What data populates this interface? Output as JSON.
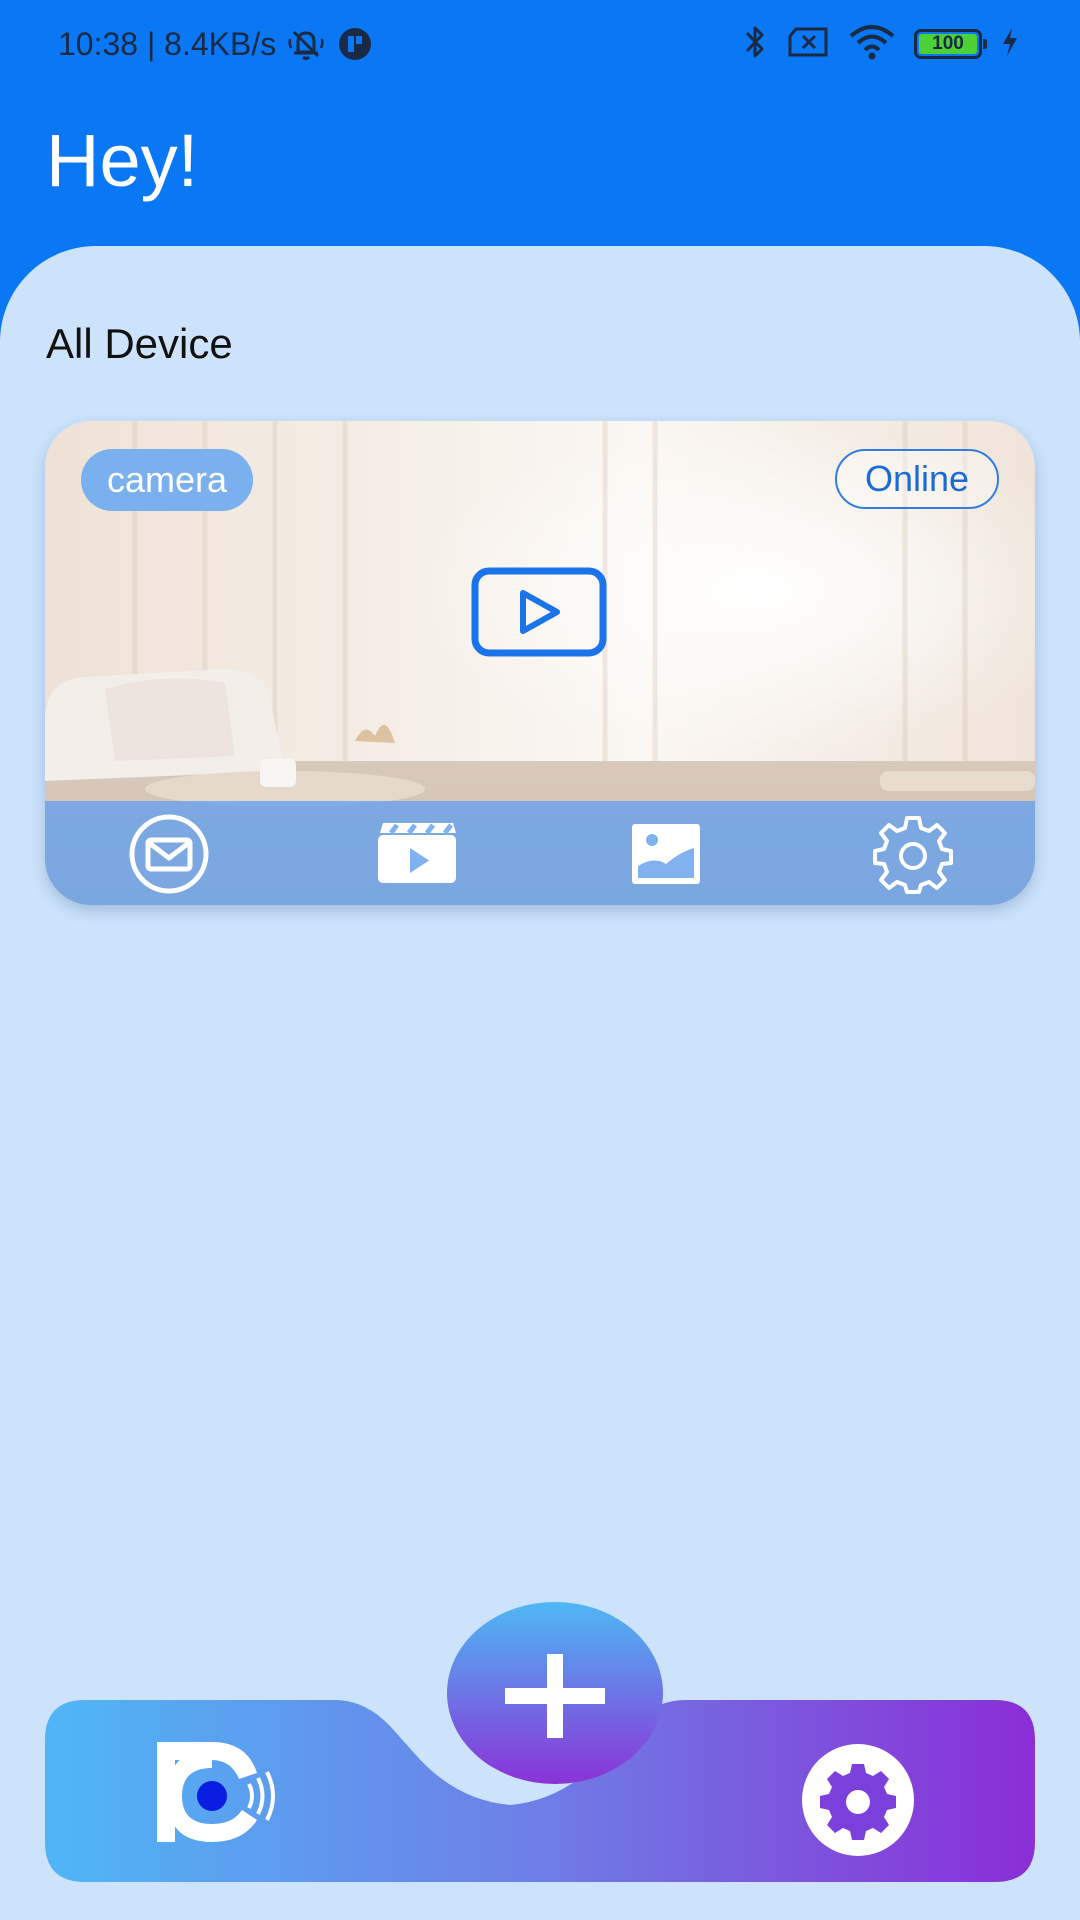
{
  "status_bar": {
    "time_speed": "10:38 | 8.4KB/s",
    "battery_level": "100",
    "icons": [
      "mute-bell-icon",
      "app-icon",
      "bluetooth-icon",
      "no-sim-icon",
      "wifi-icon",
      "battery-icon",
      "charging-icon"
    ]
  },
  "header": {
    "greeting": "Hey!"
  },
  "section": {
    "title": "All Device"
  },
  "device": {
    "type_label": "camera",
    "status": "Online",
    "actions": [
      "message-icon",
      "video-clip-icon",
      "image-icon",
      "gear-icon"
    ]
  },
  "bottom_nav": {
    "items": [
      "app-logo-icon",
      "add-icon",
      "settings-icon"
    ]
  },
  "colors": {
    "header_blue": "#0a78f5",
    "content_bg": "#cde3fb",
    "accent": "#1a73e8",
    "gradient_start": "#4fb6f6",
    "gradient_end": "#8a2ed6"
  }
}
